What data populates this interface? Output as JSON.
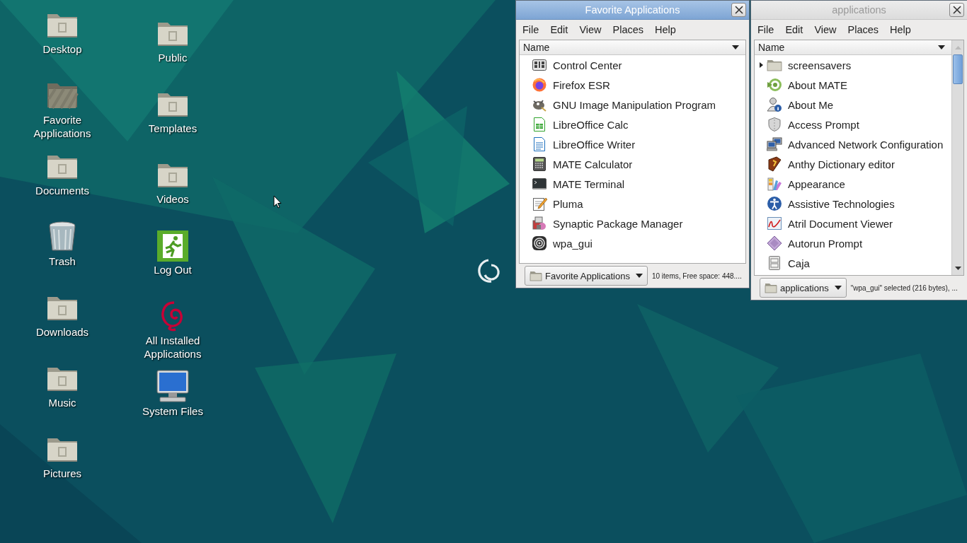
{
  "desktop": {
    "columns": [
      [
        {
          "label": "Desktop",
          "kind": "folder"
        },
        {
          "label": "Favorite Applications",
          "kind": "striped-folder"
        },
        {
          "label": "Documents",
          "kind": "folder"
        },
        {
          "label": "Trash",
          "kind": "trash"
        },
        {
          "label": "Downloads",
          "kind": "folder"
        },
        {
          "label": "Music",
          "kind": "folder"
        },
        {
          "label": "Pictures",
          "kind": "folder"
        }
      ],
      [
        {
          "label": "Public",
          "kind": "folder"
        },
        {
          "label": "Templates",
          "kind": "folder"
        },
        {
          "label": "Videos",
          "kind": "folder"
        },
        {
          "label": "Log Out",
          "kind": "exit"
        },
        {
          "label": "All Installed Applications",
          "kind": "swirl"
        },
        {
          "label": "System Files",
          "kind": "monitor"
        }
      ]
    ]
  },
  "windows": [
    {
      "title": "Favorite Applications",
      "active": true,
      "scrollable": false,
      "menu": [
        "File",
        "Edit",
        "View",
        "Places",
        "Help"
      ],
      "column_header": "Name",
      "items": [
        {
          "label": "Control Center"
        },
        {
          "label": "Firefox ESR"
        },
        {
          "label": "GNU Image Manipulation Program"
        },
        {
          "label": "LibreOffice Calc"
        },
        {
          "label": "LibreOffice Writer"
        },
        {
          "label": "MATE Calculator"
        },
        {
          "label": "MATE Terminal"
        },
        {
          "label": "Pluma"
        },
        {
          "label": "Synaptic Package Manager"
        },
        {
          "label": "wpa_gui"
        }
      ],
      "location": "Favorite Applications",
      "status": "10 items, Free space: 448...."
    },
    {
      "title": "applications",
      "active": false,
      "scrollable": true,
      "menu": [
        "File",
        "Edit",
        "View",
        "Places",
        "Help"
      ],
      "column_header": "Name",
      "items": [
        {
          "label": "screensavers",
          "expanded": false
        },
        {
          "label": "About MATE"
        },
        {
          "label": "About Me"
        },
        {
          "label": "Access Prompt"
        },
        {
          "label": "Advanced Network Configuration"
        },
        {
          "label": "Anthy Dictionary editor"
        },
        {
          "label": "Appearance"
        },
        {
          "label": "Assistive Technologies"
        },
        {
          "label": "Atril Document Viewer"
        },
        {
          "label": "Autorun Prompt"
        },
        {
          "label": "Caja"
        }
      ],
      "location": "applications",
      "status": "\"wpa_gui\" selected (216 bytes), ..."
    }
  ]
}
